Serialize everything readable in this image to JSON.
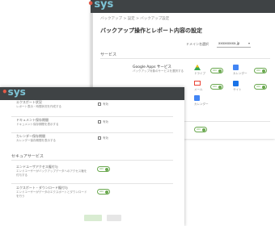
{
  "back": {
    "logo": "sys",
    "breadcrumb": [
      "バックアップ",
      "設定",
      "バックアップ設定"
    ],
    "title": "バックアップ操作とレポート内容の設定",
    "domain_label": "ドメイン名選択",
    "domain_value": "xxxxxxxxx.jp",
    "section": "サービス",
    "google_apps": {
      "title": "Google Apps サービス",
      "desc": "バックアップ対象のサービスを選択する"
    },
    "services": [
      {
        "name": "ドライブ",
        "toggle": "ON",
        "color": "#34a853"
      },
      {
        "name": "カレンダー",
        "toggle": "ON",
        "color": "#4285f4"
      },
      {
        "name": "メール",
        "toggle": "ON",
        "color": "#ea4335"
      },
      {
        "name": "サイト",
        "toggle": "ON",
        "color": "#1a73e8"
      },
      {
        "name": "カレンダー",
        "toggle": "",
        "color": "#4285f4"
      }
    ],
    "bottom_toggle": "ON"
  },
  "front": {
    "logo": "sys",
    "items": [
      {
        "title": "エクスポート状況",
        "desc": "レポート表示・時間状況を作成する",
        "check": "有効"
      },
      {
        "title": "ドキュメント保存期間",
        "desc": "ドキュメント保存期間を表示する",
        "check": "有効"
      },
      {
        "title": "カレンダー保存期間",
        "desc": "カレンダー保存期間を表示する",
        "check": "有効"
      }
    ],
    "section": "セキュアサービス",
    "secure": [
      {
        "title": "エンドユーザアクセス権付与",
        "desc": "エンドユーザーがバックアップデータへのアクセス権を付与する",
        "toggle": "ON"
      },
      {
        "title": "エクスポート・ダウンロード権付与",
        "desc": "エンドユーザーがデータのエクスポートとダウンロードを行う",
        "toggle": "ON"
      }
    ],
    "accent": "#6aa84f"
  }
}
